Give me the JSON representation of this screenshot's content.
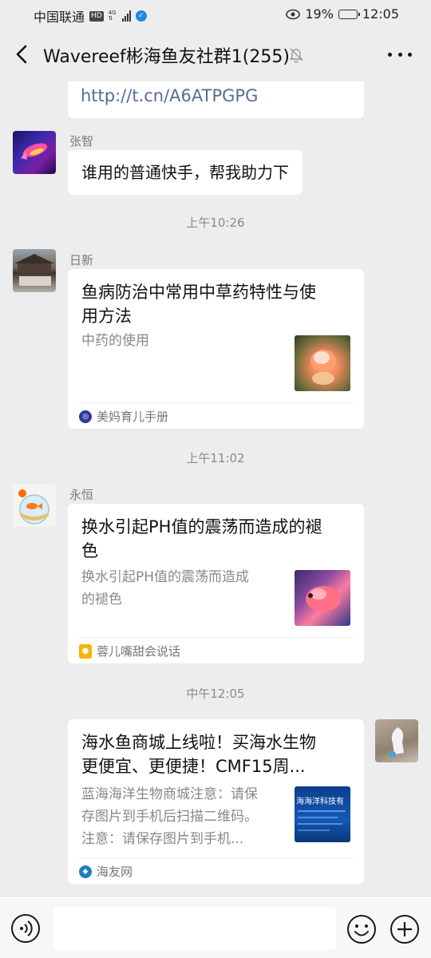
{
  "status_bar": {
    "carrier": "中国联通",
    "hd": "HD",
    "network": "4G",
    "battery_percent": "19%",
    "battery_level": 0.19,
    "time": "12:05"
  },
  "header": {
    "title": "Wavereef彬海鱼友社群1(255)"
  },
  "messages": {
    "partial_link": "http://t.cn/A6ATPGPG",
    "m1": {
      "sender": "张智",
      "text": "谁用的普通快手，帮我助力下"
    },
    "ts1": "上午10:26",
    "m2": {
      "sender": "日新",
      "title_line1": "鱼病防治中常用中草药特性与使",
      "title_line2": "用方法",
      "desc": "中药的使用",
      "source": "美妈育儿手册"
    },
    "ts2": "上午11:02",
    "m3": {
      "sender": "永恒",
      "title_line1": "换水引起PH值的震荡而造成的褪",
      "title_line2": "色",
      "desc_line1": "换水引起PH值的震荡而造成",
      "desc_line2": "的褪色",
      "source": "蓉儿嘴甜会说话"
    },
    "ts3": "中午12:05",
    "m4": {
      "title_line1": "海水鱼商城上线啦！买海水生物",
      "title_line2": "更便宜、更便捷！CMF15周...",
      "desc_line1": "蓝海海洋生物商城注意：请保",
      "desc_line2": "存图片到手机后扫描二维码。",
      "desc_line3": "注意：请保存图片到手机...",
      "thumb_text": "海海洋科技有",
      "source": "海友网"
    }
  },
  "input_bar": {
    "placeholder": ""
  },
  "colors": {
    "background": "#ededed",
    "bubble": "#ffffff",
    "link": "#576b95",
    "battery": "#f09a22"
  }
}
